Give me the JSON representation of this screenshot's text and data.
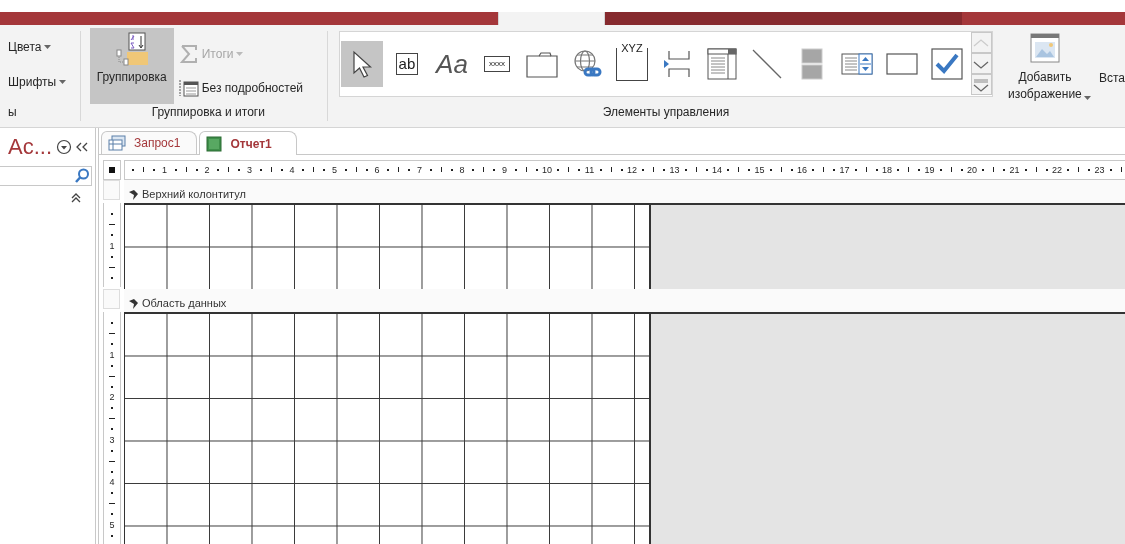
{
  "ribbon_tabs": [
    {
      "kind": "main",
      "selected": false
    },
    {
      "kind": "main",
      "selected": true
    },
    {
      "kind": "contextual",
      "selected": false
    },
    {
      "kind": "main",
      "selected": false
    }
  ],
  "ribbon": {
    "groups": [
      {
        "kind": "stack",
        "label": "ы",
        "items": [
          {
            "label": "Цвета",
            "dropdown": true,
            "disabled": false
          },
          {
            "label": "Шрифты",
            "dropdown": true,
            "disabled": false
          }
        ]
      },
      {
        "kind": "grouping",
        "label": "Группировка и итоги",
        "large": {
          "label": "Группировка",
          "selected": true
        },
        "items": [
          {
            "label": "Итоги",
            "dropdown": true,
            "disabled": true
          },
          {
            "label": "Без подробностей",
            "dropdown": false,
            "disabled": false
          }
        ]
      },
      {
        "kind": "gallery",
        "label": "Элементы управления",
        "controls": [
          {
            "selected": true
          },
          {
            "glyph": "ab",
            "selected": false
          },
          {
            "glyph": "Aa",
            "selected": false
          },
          {
            "glyph": "xxxx",
            "selected": false
          },
          {
            "selected": false
          },
          {
            "selected": false
          },
          {
            "glyph": "XYZ",
            "selected": false
          },
          {
            "selected": false
          },
          {
            "selected": false
          },
          {
            "selected": false
          },
          {
            "selected": false
          },
          {
            "selected": false
          },
          {
            "selected": false
          },
          {
            "selected": false
          }
        ]
      },
      {
        "kind": "insert",
        "items": [
          {
            "label": "Добавить изображение",
            "dropdown": true
          },
          {
            "label": "Вста"
          }
        ]
      }
    ]
  },
  "navigation_pane": {
    "title": "Ас..."
  },
  "document_tabs": [
    {
      "kind": "query",
      "label": "Запрос1",
      "selected": false
    },
    {
      "kind": "report",
      "label": "Отчет1",
      "selected": true
    }
  ],
  "designer": {
    "ruler_marks": [
      "1",
      "2",
      "3",
      "4",
      "5",
      "6",
      "7",
      "8",
      "9",
      "10",
      "11",
      "12",
      "13",
      "14",
      "15",
      "16",
      "17",
      "18",
      "19",
      "20",
      "21",
      "22",
      "23"
    ],
    "sections": [
      {
        "kind": "page_header",
        "title": "Верхний колонтитул",
        "ruler_marks": [
          "1"
        ]
      },
      {
        "kind": "detail",
        "title": "Область данных",
        "ruler_marks": [
          "1",
          "2",
          "3",
          "4",
          "5"
        ]
      }
    ]
  }
}
